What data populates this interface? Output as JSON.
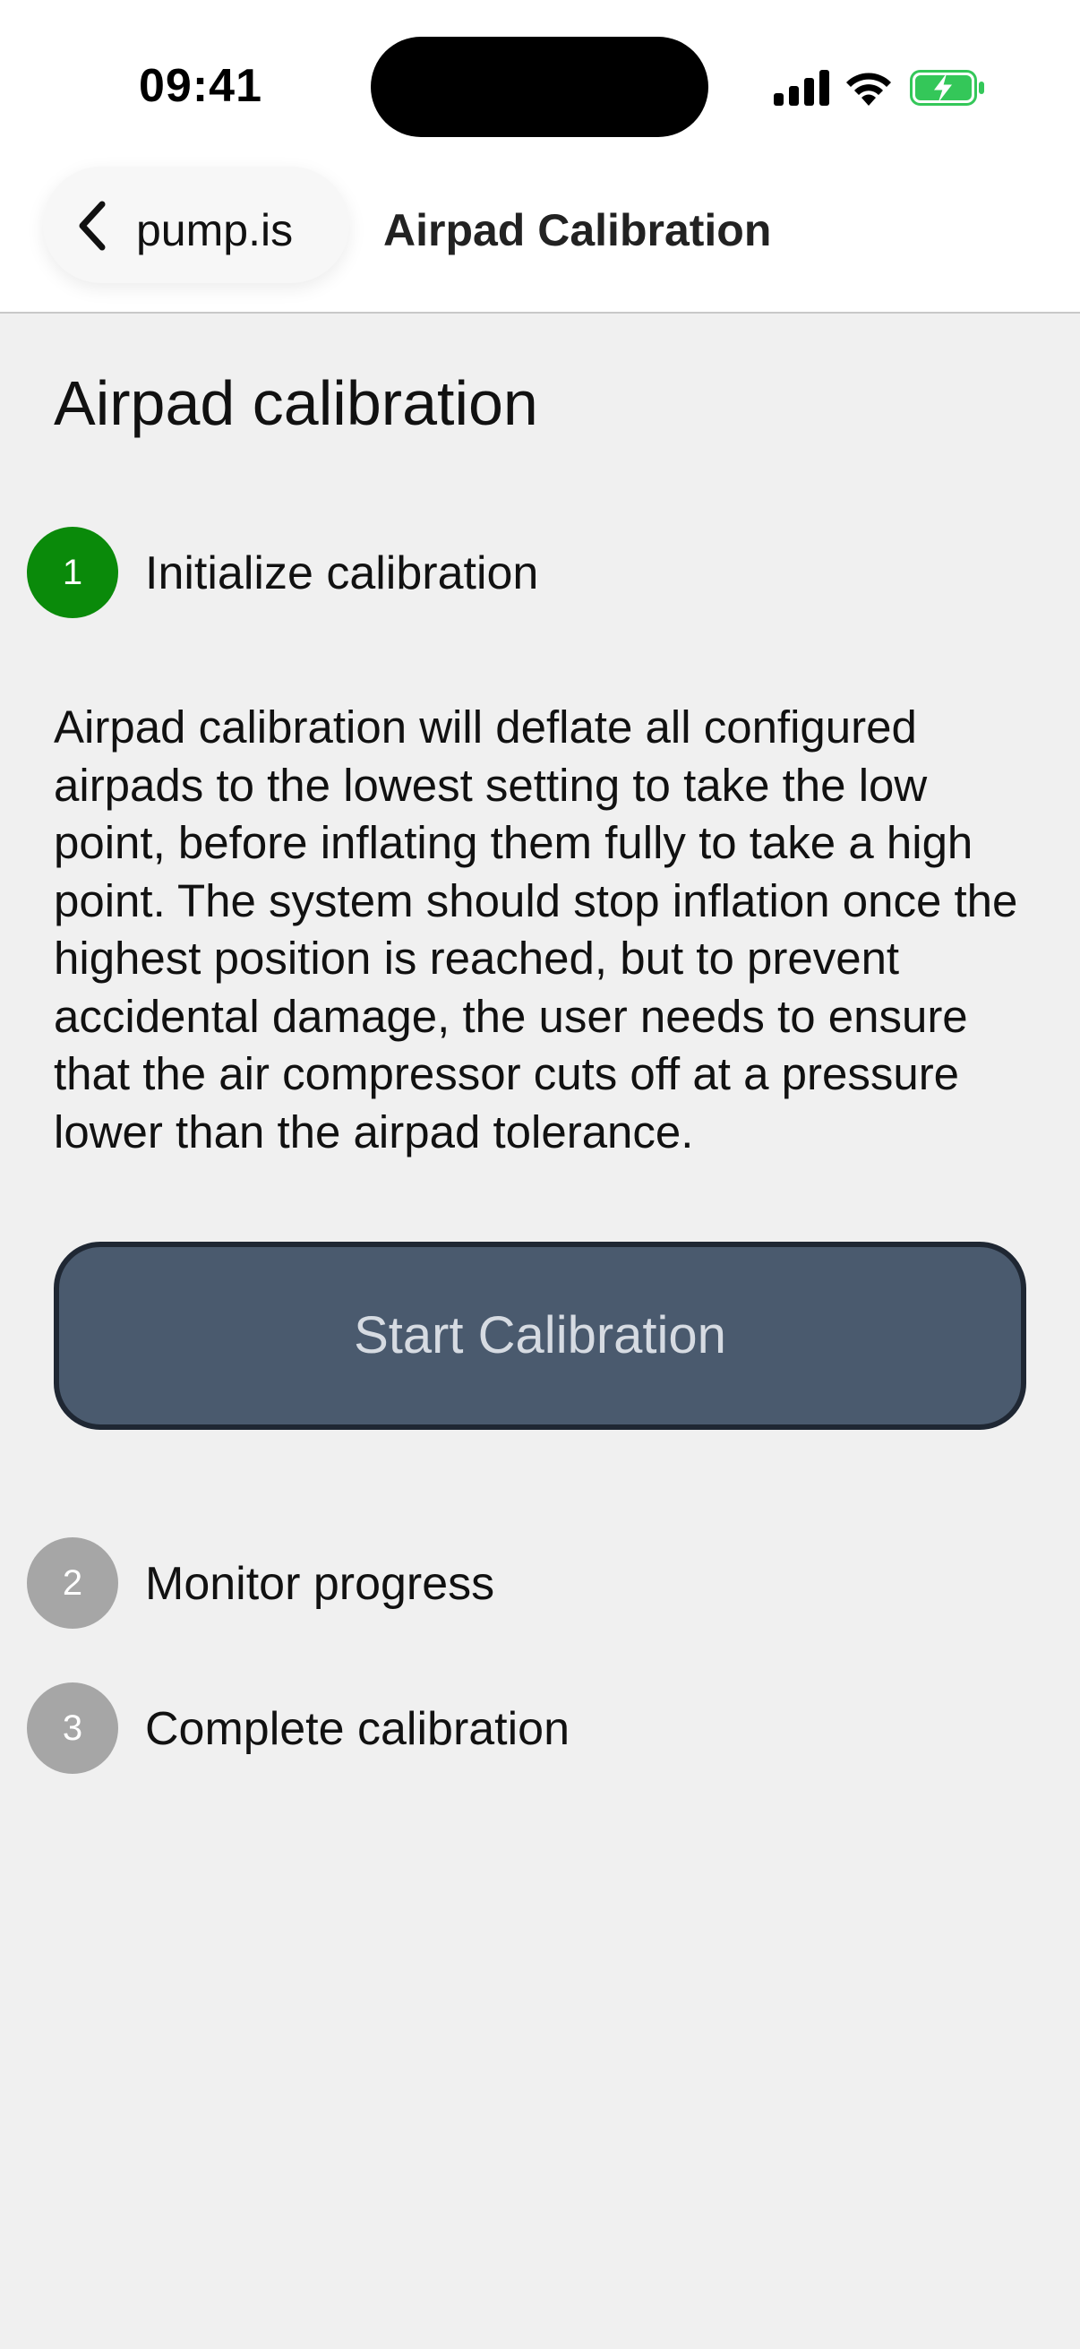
{
  "status_bar": {
    "time": "09:41"
  },
  "nav": {
    "back_label": "pump.is",
    "title": "Airpad Calibration"
  },
  "content": {
    "heading": "Airpad calibration",
    "steps": [
      {
        "number": "1",
        "label": "Initialize calibration",
        "state": "active",
        "color": "#0a8a0a"
      },
      {
        "number": "2",
        "label": "Monitor progress",
        "state": "pending",
        "color": "#a6a6a6"
      },
      {
        "number": "3",
        "label": "Complete calibration",
        "state": "pending",
        "color": "#a6a6a6"
      }
    ],
    "description": "Airpad calibration will deflate all configured airpads to the lowest setting to take the low point, before inflating them fully to take a high point. The system should stop inflation once the highest position is reached, but to prevent accidental damage, the user needs to ensure that the air compressor cuts off at a pressure lower than the airpad tolerance.",
    "start_button_label": "Start Calibration"
  },
  "colors": {
    "button_bg": "#4a5a6e",
    "button_border": "#1f2733",
    "battery_green": "#34c759"
  },
  "icons": {
    "back": "chevron-left-icon",
    "signal": "cellular-signal-icon",
    "wifi": "wifi-icon",
    "battery": "battery-charging-icon"
  }
}
